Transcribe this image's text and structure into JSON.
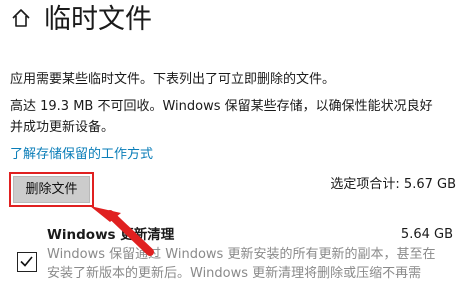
{
  "header": {
    "title": "临时文件",
    "home_icon": "home-icon"
  },
  "info": {
    "line1": "应用需要某些临时文件。下表列出了可立即删除的文件。",
    "line2": "高达 19.3 MB 不可回收。Windows 保留某些存储，以确保性能状况良好",
    "line3": "并成功更新设备。",
    "link": "了解存储保留的工作方式"
  },
  "actions": {
    "delete_label": "删除文件",
    "selected_total_label": "选定项合计: 5.67 GB"
  },
  "items": [
    {
      "title": "Windows 更新清理",
      "size": "5.64 GB",
      "desc_line1": "Windows 保留通过 Windows 更新安装的所有更新的副本，甚至在",
      "desc_line2": "安装了新版本的更新后。Windows 更新清理将删除或压缩不再需",
      "checked": true
    }
  ],
  "colors": {
    "accent_link": "#0a7db8",
    "highlight": "#e02020",
    "button_bg": "#cccccc"
  }
}
